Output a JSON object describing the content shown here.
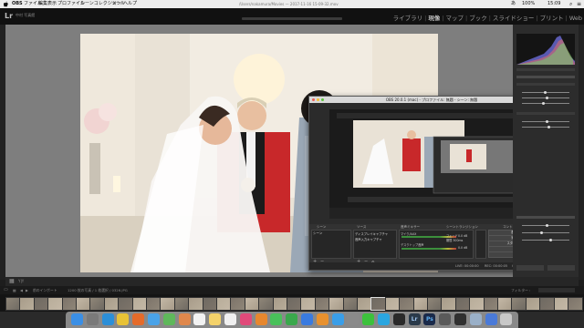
{
  "menubar": {
    "app_name": "OBS",
    "items": [
      "ファイル",
      "編集",
      "表示",
      "プロファイル",
      "シーンコレクション",
      "ツール",
      "ヘルプ"
    ],
    "center_text": "/Users/nakamura/Movies — 2017-11-16 15-09-32.mov",
    "status": {
      "input_source": "あ",
      "battery": "100%",
      "time": "15:09"
    }
  },
  "lightroom": {
    "logo": "Lr",
    "catalog_name": "中村 写真館",
    "modules": [
      {
        "label": "ライブラリ",
        "active": false
      },
      {
        "label": "現像",
        "active": true
      },
      {
        "label": "マップ",
        "active": false
      },
      {
        "label": "ブック",
        "active": false
      },
      {
        "label": "スライドショー",
        "active": false
      },
      {
        "label": "プリント",
        "active": false
      },
      {
        "label": "Web",
        "active": false
      }
    ],
    "toolbar": {
      "left_text": "ツールバー表示",
      "view_label": "Y|Y"
    },
    "filmstrip_info": {
      "path": "前のインポート",
      "count": "1200 枚の写真 / 1 枚選択 / 0326.JPG",
      "filter_label": "フィルター :"
    },
    "filmstrip_count": 41,
    "selected_thumb": 26
  },
  "obs": {
    "title": "OBS 20.0.1 (mac) - プロファイル: 無題 - シーン: 無題",
    "docks": {
      "scenes": "シーン",
      "sources": "ソース",
      "mixer": "音声ミキサー",
      "transitions": "シーントランジション",
      "controls": "コントロール"
    },
    "scene_items": [
      "シーン"
    ],
    "source_items": [
      "ディスプレイキャプチャ",
      "音声入力キャプチャ"
    ],
    "mixer_tracks": [
      {
        "name": "マイク/AUX",
        "db": "0.0 dB"
      },
      {
        "name": "デスクトップ音声",
        "db": "0.0 dB"
      }
    ],
    "transition": {
      "name": "フェード",
      "duration_label": "期間",
      "duration_value": "300ms"
    },
    "buttons": [
      "配信開始",
      "録画停止",
      "スタジオモード",
      "設定",
      "終了"
    ],
    "status": {
      "live": "LIVE: 00:00:00",
      "rec": "REC: 00:00:05",
      "cpu": "CPU: 2.6%, 30.00 fps"
    }
  },
  "dock_icons": [
    {
      "name": "finder-icon",
      "color": "#3b8fe5"
    },
    {
      "name": "launchpad-icon",
      "color": "#7a7a7a"
    },
    {
      "name": "safari-icon",
      "color": "#2c8fd8"
    },
    {
      "name": "chrome-icon",
      "color": "#e8c236"
    },
    {
      "name": "firefox-icon",
      "color": "#e56b2a"
    },
    {
      "name": "mail-icon",
      "color": "#4aa3e8"
    },
    {
      "name": "maps-icon",
      "color": "#5fb85b"
    },
    {
      "name": "photos-icon",
      "color": "#e0884c"
    },
    {
      "name": "calendar-icon",
      "color": "#f2f2f2"
    },
    {
      "name": "notes-icon",
      "color": "#f4d26a"
    },
    {
      "name": "reminders-icon",
      "color": "#f0f0f0"
    },
    {
      "name": "itunes-icon",
      "color": "#e14a7a"
    },
    {
      "name": "ibooks-icon",
      "color": "#e7872e"
    },
    {
      "name": "facetime-icon",
      "color": "#49c15a"
    },
    {
      "name": "numbers-icon",
      "color": "#3aa84c"
    },
    {
      "name": "keynote-icon",
      "color": "#3a7be0"
    },
    {
      "name": "pages-icon",
      "color": "#e8912e"
    },
    {
      "name": "appstore-icon",
      "color": "#3a9ee8"
    },
    {
      "name": "preferences-icon",
      "color": "#8a8a8a"
    },
    {
      "name": "line-icon",
      "color": "#3cc13c"
    },
    {
      "name": "skype-icon",
      "color": "#2aa6e0"
    },
    {
      "name": "terminal-icon",
      "color": "#2a2a2a"
    },
    {
      "name": "lightroom-icon",
      "color": "#2a3a4a"
    },
    {
      "name": "photoshop-icon",
      "color": "#1a2a4a"
    },
    {
      "name": "quicktime-icon",
      "color": "#5a5a5a"
    },
    {
      "name": "obs-icon",
      "color": "#303030"
    },
    {
      "name": "preview-icon",
      "color": "#9ab0c8"
    },
    {
      "name": "downloads-icon",
      "color": "#4a7ad8"
    },
    {
      "name": "trash-icon",
      "color": "#c8c8c8"
    }
  ],
  "dock_labels": {
    "lightroom": "Lr",
    "photoshop": "Ps"
  },
  "colors": {
    "lr_accent": "#ffffff",
    "obs_meter_green": "#3c8f3c",
    "obs_meter_red": "#b83a3a"
  }
}
